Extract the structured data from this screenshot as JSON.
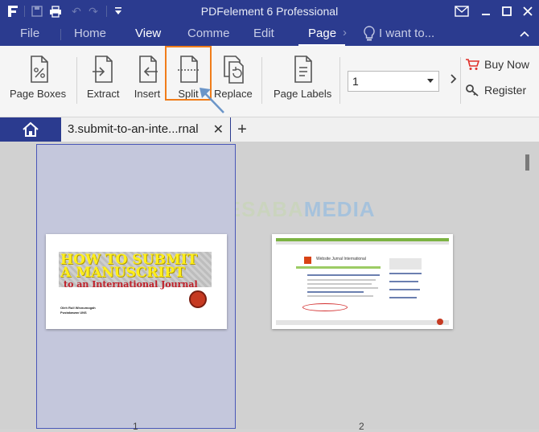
{
  "window": {
    "title": "PDFelement 6 Professional"
  },
  "menu": {
    "file": "File",
    "home": "Home",
    "view": "View",
    "comment": "Comme",
    "edit": "Edit",
    "page": "Page",
    "search_placeholder": "I want to..."
  },
  "ribbon": {
    "page_boxes": "Page Boxes",
    "extract": "Extract",
    "insert": "Insert",
    "split": "Split",
    "replace": "Replace",
    "page_labels": "Page Labels",
    "page_select_value": "1",
    "buy_now": "Buy Now",
    "register": "Register"
  },
  "tabs": {
    "document": "3.submit-to-an-inte...rnal"
  },
  "watermark": {
    "part1": "NESABA",
    "part2": "MEDIA"
  },
  "thumbnails": {
    "page1": {
      "heading_line1": "HOW TO SUBMIT",
      "heading_line2": "A MANUSCRIPT",
      "heading_line3": "to an International Journal",
      "author_line1": "Oleh Ruli Wisnumogah",
      "author_line2": "Pustakawan UNS"
    },
    "page2": {
      "site_title": "Website Jurnal International"
    }
  },
  "page_numbers": [
    "1",
    "2"
  ],
  "colors": {
    "titlebar": "#2b3b8f",
    "highlight": "#f07d1a",
    "arrow": "#6b95c8"
  }
}
